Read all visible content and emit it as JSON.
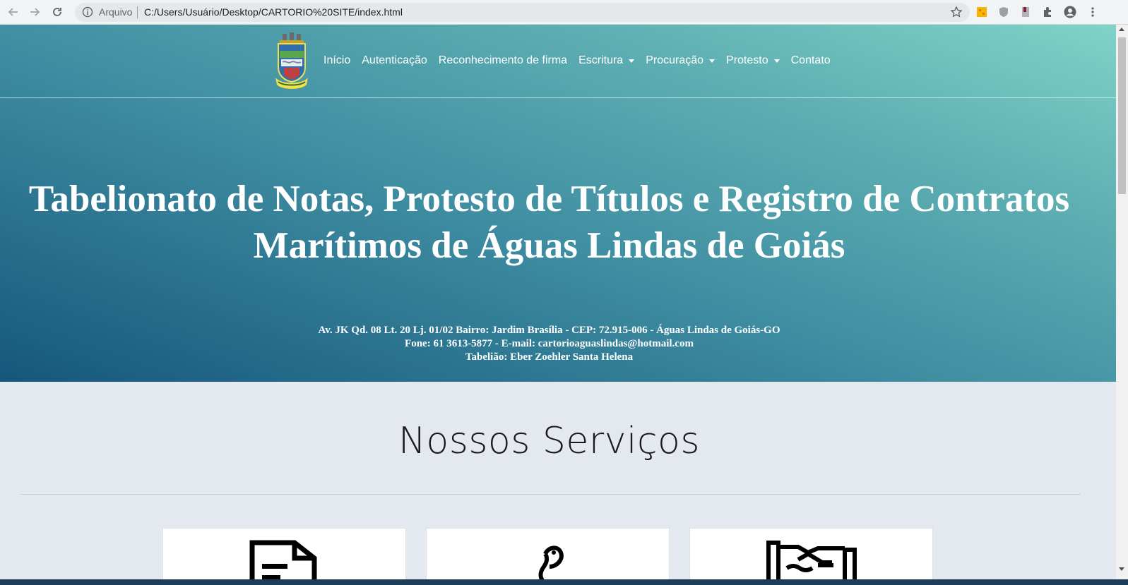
{
  "browser": {
    "scheme_label": "Arquivo",
    "url": "C:/Users/Usuário/Desktop/CARTORIO%20SITE/index.html",
    "icons": [
      "back-icon",
      "forward-icon",
      "reload-icon",
      "info-icon",
      "bookmark-star-icon",
      "extension-icon",
      "shield-icon",
      "bookmark-icon",
      "puzzle-icon",
      "profile-icon",
      "menu-kebab-icon"
    ]
  },
  "navbar": {
    "logo": "municipal-coat-of-arms",
    "items": [
      {
        "label": "Início",
        "dropdown": false
      },
      {
        "label": "Autenticação",
        "dropdown": false
      },
      {
        "label": "Reconhecimento de firma",
        "dropdown": false
      },
      {
        "label": "Escritura",
        "dropdown": true
      },
      {
        "label": "Procuração",
        "dropdown": true
      },
      {
        "label": "Protesto",
        "dropdown": true
      },
      {
        "label": "Contato",
        "dropdown": false
      }
    ]
  },
  "hero": {
    "title_line1": "Tabelionato de Notas, Protesto de Títulos e Registro de Contratos",
    "title_line2": "Marítimos de Águas Lindas de Goiás",
    "address": "Av. JK Qd. 08 Lt. 20 Lj. 01/02 Bairro: Jardim Brasília - CEP: 72.915-006 - Águas Lindas de Goiás-GO",
    "contact": "Fone: 61 3613-5877 - E-mail: cartorioaguaslindas@hotmail.com",
    "notary": "Tabelião: Eber Zoehler Santa Helena"
  },
  "services": {
    "title": "Nossos Serviços",
    "cards": [
      {
        "icon": "document-icon"
      },
      {
        "icon": "pen-nib-icon"
      },
      {
        "icon": "handshake-icon"
      }
    ]
  },
  "colors": {
    "hero_gradient_light": "#7fd3c8",
    "hero_gradient_dark": "#15577c",
    "page_background": "#e3e9ef"
  }
}
